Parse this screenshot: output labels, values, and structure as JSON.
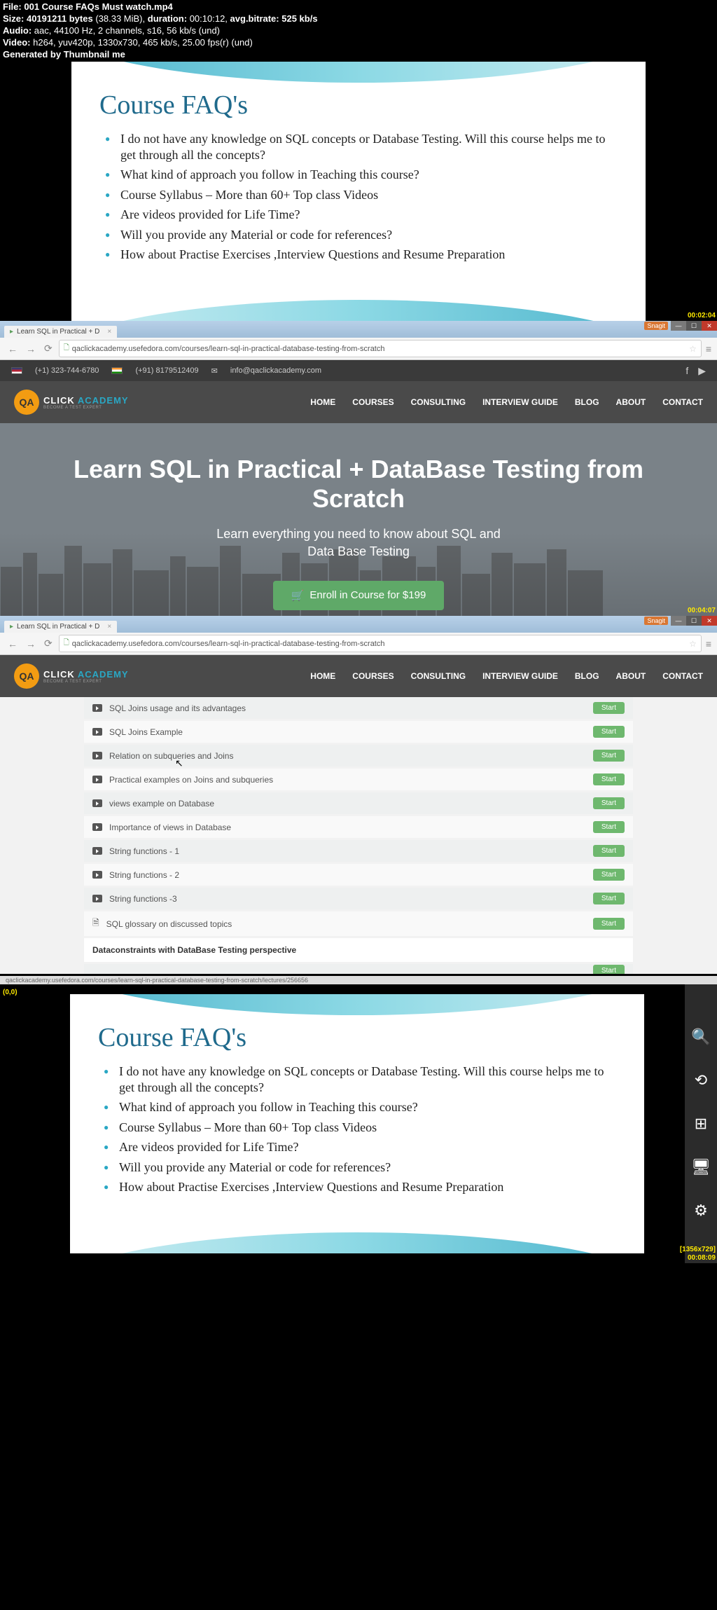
{
  "meta": {
    "file_label": "File:",
    "file": "001 Course FAQs Must watch.mp4",
    "size_label": "Size:",
    "size_bytes": "40191211",
    "size_unit": "bytes",
    "size_mib": "(38.33 MiB),",
    "duration_label": "duration:",
    "duration": "00:10:12,",
    "avgbr_label": "avg.bitrate:",
    "avgbr": "525 kb/s",
    "audio_label": "Audio:",
    "audio": "aac, 44100 Hz, 2 channels, s16, 56 kb/s (und)",
    "video_label": "Video:",
    "video": "h264, yuv420p, 1330x730, 465 kb/s, 25.00 fps(r) (und)",
    "generated": "Generated by Thumbnail me"
  },
  "faq": {
    "title": "Course FAQ's",
    "items": [
      "I do not have any knowledge on SQL concepts  or Database Testing. Will this course helps me to get through all the concepts?",
      "What kind of approach you follow in Teaching this course?",
      " Course Syllabus – More than 60+ Top class Videos",
      "Are videos provided for Life Time?",
      "Will you provide any Material or code for references?",
      "How about Practise Exercises ,Interview Questions and Resume Preparation "
    ]
  },
  "timestamps": {
    "p1": "00:02:04",
    "p2": "00:04:07",
    "p4": "00:08:09"
  },
  "coords": {
    "p4_tl": "(0,0)",
    "p4_br": "[1356x729]"
  },
  "browser": {
    "tab_title": "Learn SQL in Practical + D",
    "url": "qaclickacademy.usefedora.com/courses/learn-sql-in-practical-database-testing-from-scratch",
    "status_url": "qaclickacademy.usefedora.com/courses/learn-sql-in-practical-database-testing-from-scratch/lectures/256656",
    "snagit": "Snagit"
  },
  "topbar": {
    "phone_us": "(+1) 323-744-6780",
    "phone_in": "(+91) 8179512409",
    "email": "info@qaclickacademy.com"
  },
  "logo": {
    "icon": "QA",
    "click": "CLICK ",
    "academy": "ACADEMY",
    "sub": "BECOME A TEST EXPERT"
  },
  "nav": [
    "HOME",
    "COURSES",
    "CONSULTING",
    "INTERVIEW GUIDE",
    "BLOG",
    "ABOUT",
    "CONTACT"
  ],
  "hero": {
    "title_l1": "Learn SQL in Practical + DataBase Testing from",
    "title_l2": "Scratch",
    "sub_l1": "Learn everything you need to know about SQL and",
    "sub_l2": "Data Base Testing",
    "enroll": "Enroll in Course for $199"
  },
  "lectures": [
    {
      "title": "SQL Joins usage and its advantages",
      "btn": "Start"
    },
    {
      "title": "SQL Joins Example",
      "btn": "Start"
    },
    {
      "title": "Relation on subqueries and Joins",
      "btn": "Start"
    },
    {
      "title": "Practical examples on Joins and subqueries",
      "btn": "Start"
    },
    {
      "title": "views example on Database",
      "btn": "Start"
    },
    {
      "title": "Importance of views in Database",
      "btn": "Start"
    },
    {
      "title": "String functions - 1",
      "btn": "Start"
    },
    {
      "title": "String functions - 2",
      "btn": "Start"
    },
    {
      "title": "String functions -3",
      "btn": "Start"
    },
    {
      "title": "SQL glossary on discussed topics",
      "btn": "Start",
      "doc": true
    }
  ],
  "section_head": "Dataconstraints with DataBase Testing perspective",
  "start_hidden": "Start"
}
